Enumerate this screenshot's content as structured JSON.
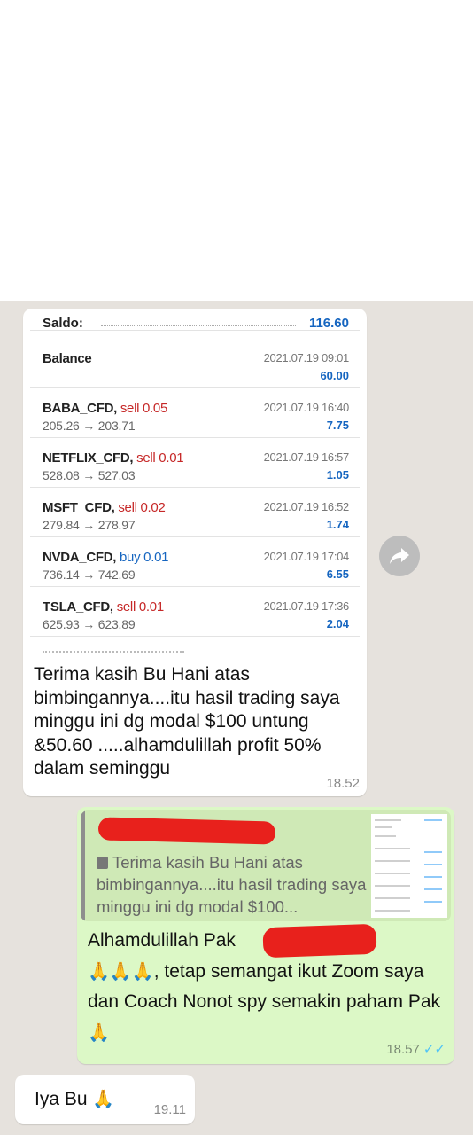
{
  "incoming_message": {
    "screenshot": {
      "saldo_label": "Saldo:",
      "saldo_value": "116.60",
      "rows": [
        {
          "symbol": "Balance",
          "side": "",
          "prices": "",
          "timestamp": "2021.07.19 09:01",
          "profit": "60.00",
          "side_type": "none"
        },
        {
          "symbol": "BABA_CFD,",
          "side": "sell 0.05",
          "prices": "205.26 → 203.71",
          "timestamp": "2021.07.19 16:40",
          "profit": "7.75",
          "side_type": "sell"
        },
        {
          "symbol": "NETFLIX_CFD,",
          "side": "sell 0.01",
          "prices": "528.08 → 527.03",
          "timestamp": "2021.07.19 16:57",
          "profit": "1.05",
          "side_type": "sell"
        },
        {
          "symbol": "MSFT_CFD,",
          "side": "sell 0.02",
          "prices": "279.84 → 278.97",
          "timestamp": "2021.07.19 16:52",
          "profit": "1.74",
          "side_type": "sell"
        },
        {
          "symbol": "NVDA_CFD,",
          "side": "buy 0.01",
          "prices": "736.14 → 742.69",
          "timestamp": "2021.07.19 17:04",
          "profit": "6.55",
          "side_type": "buy"
        },
        {
          "symbol": "TSLA_CFD,",
          "side": "sell 0.01",
          "prices": "625.93 → 623.89",
          "timestamp": "2021.07.19 17:36",
          "profit": "2.04",
          "side_type": "sell"
        }
      ]
    },
    "text": "Terima kasih Bu Hani atas bimbingannya....itu hasil trading saya minggu ini dg modal $100 untung &50.60 .....alhamdulillah profit 50% dalam seminggu",
    "time": "18.52"
  },
  "outgoing_message": {
    "quote_text": "Terima kasih Bu Hani atas bimbingannya....itu hasil trading saya minggu ini dg modal $100...",
    "text_line1": "Alhamdulillah Pak",
    "emoji_clap": "👐👐👐",
    "emoji_pray": "🙏🙏🙏",
    "text_rest": ", tetap semangat ikut Zoom saya dan Coach Nonot spy semakin paham Pak",
    "emoji_end": "🙏",
    "time": "18.57",
    "ticks": "✓✓"
  },
  "reply_message": {
    "text": "Iya Bu",
    "emoji": "🙏",
    "time": "19.11"
  },
  "colors": {
    "chat_background": "#e6e2dd",
    "outgoing_bubble": "#dcf8c6",
    "sell": "#c62828",
    "buy": "#1565c0",
    "redaction": "#e8211c"
  },
  "icons": [
    "forward-icon",
    "document-icon",
    "double-check-icon"
  ]
}
